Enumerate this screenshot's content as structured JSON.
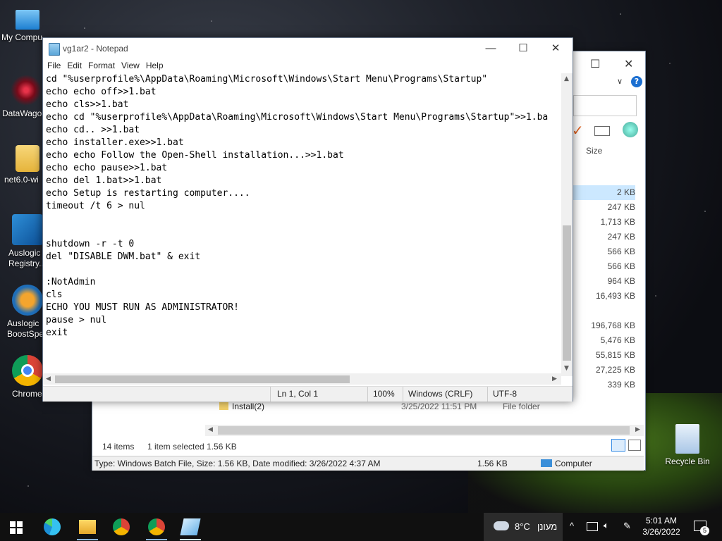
{
  "desktop": {
    "icons": [
      {
        "label": "My Compu"
      },
      {
        "label": "DataWago"
      },
      {
        "label": "net6.0-wi"
      },
      {
        "label": "Auslogic Registry..."
      },
      {
        "label": "Auslogic BoostSpe"
      },
      {
        "label": "Chrome"
      },
      {
        "label": "Recycle Bin"
      }
    ]
  },
  "explorer": {
    "column_size": "Size",
    "sizes": [
      "2 KB",
      "247 KB",
      "1,713 KB",
      "247 KB",
      "566 KB",
      "566 KB",
      "964 KB",
      "16,493 KB",
      "",
      "196,768 KB",
      "5,476 KB",
      "55,815 KB",
      "27,225 KB",
      "339 KB"
    ],
    "install_row": {
      "name": "Install(2)",
      "date": "3/25/2022 11:51 PM",
      "type": "File folder"
    },
    "items_count": "14 items",
    "selected": "1 item selected  1.56 KB",
    "status_details": "Type: Windows Batch File, Size: 1.56 KB, Date modified: 3/26/2022 4:37 AM",
    "status_size": "1.56 KB",
    "status_location": "Computer"
  },
  "notepad": {
    "title": "vg1ar2 - Notepad",
    "menu": [
      "File",
      "Edit",
      "Format",
      "View",
      "Help"
    ],
    "content": "cd \"%userprofile%\\AppData\\Roaming\\Microsoft\\Windows\\Start Menu\\Programs\\Startup\"\necho echo off>>1.bat\necho cls>>1.bat\necho cd \"%userprofile%\\AppData\\Roaming\\Microsoft\\Windows\\Start Menu\\Programs\\Startup\">>1.ba\necho cd.. >>1.bat\necho installer.exe>>1.bat\necho echo Follow the Open-Shell installation...>>1.bat\necho echo pause>>1.bat\necho del 1.bat>>1.bat\necho Setup is restarting computer....\ntimeout /t 6 > nul\n\n\nshutdown -r -t 0\ndel \"DISABLE DWM.bat\" & exit\n\n:NotAdmin\ncls\nECHO YOU MUST RUN AS ADMINISTRATOR!\npause > nul\nexit",
    "status": {
      "position": "Ln 1, Col 1",
      "zoom": "100%",
      "line_endings": "Windows (CRLF)",
      "encoding": "UTF-8"
    }
  },
  "taskbar": {
    "weather_temp": "8°C",
    "weather_text": "מעונן",
    "time": "5:01 AM",
    "date": "3/26/2022",
    "notifications": "5"
  }
}
